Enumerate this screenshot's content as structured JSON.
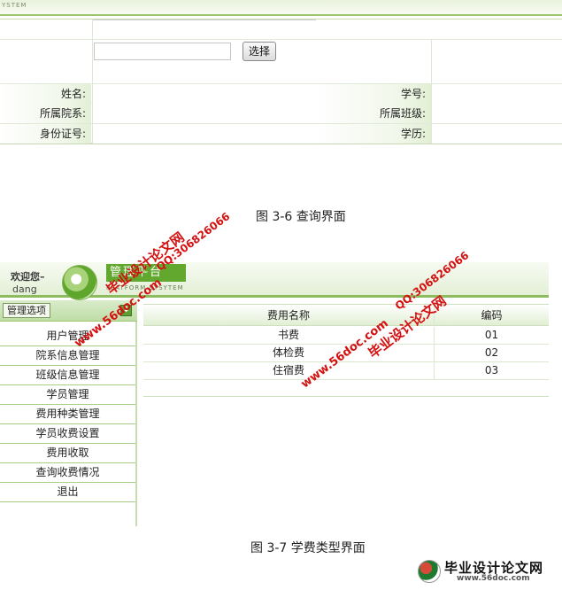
{
  "top_header": {
    "system_text": "YSTEM"
  },
  "query_form": {
    "select_button": "选择",
    "labels": {
      "name": "姓名:",
      "student_id": "学号:",
      "department": "所属院系:",
      "class": "所属班级:",
      "id_number": "身份证号:",
      "education": "学历:"
    }
  },
  "captions": {
    "fig1": "图 3-6 查询界面",
    "fig2": "图 3-7 学费类型界面"
  },
  "app": {
    "welcome": "欢迎您–",
    "username": "dang",
    "logo_title": "管理平台",
    "logo_subtitle": "PLATFORM SYSYTEM",
    "menu_title": "管理选项",
    "menu_arrow": "⬇",
    "menu_items": [
      "用户管理",
      "院系信息管理",
      "班级信息管理",
      "学员管理",
      "费用种类管理",
      "学员收费设置",
      "费用收取",
      "查询收费情况",
      "退出"
    ],
    "table": {
      "headers": [
        "费用名称",
        "编码"
      ],
      "rows": [
        {
          "name": "书费",
          "code": "01"
        },
        {
          "name": "体检费",
          "code": "02"
        },
        {
          "name": "住宿费",
          "code": "03"
        }
      ]
    }
  },
  "watermarks": {
    "site_cn": "毕业设计论文网",
    "url": "www.56doc.com",
    "qq": "QQ:306826066"
  },
  "brand": {
    "name": "毕业设计论文网",
    "url": "www.56doc.com"
  },
  "colors": {
    "accent_green": "#8dbb5f",
    "watermark_red": "#d41010"
  }
}
